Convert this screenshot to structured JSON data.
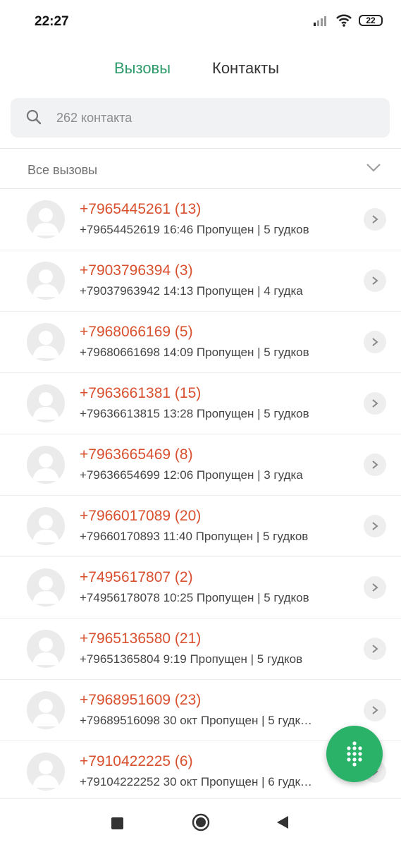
{
  "status": {
    "time": "22:27",
    "battery": "22"
  },
  "tabs": {
    "calls": "Вызовы",
    "contacts": "Контакты"
  },
  "search": {
    "placeholder": "262 контакта"
  },
  "filter": {
    "label": "Все вызовы"
  },
  "calls": [
    {
      "title": "+7965445261 (13)",
      "sub": "+79654452619  16:46 Пропущен | 5 гудков"
    },
    {
      "title": "+7903796394 (3)",
      "sub": "+79037963942  14:13 Пропущен | 4 гудка"
    },
    {
      "title": "+7968066169 (5)",
      "sub": "+79680661698  14:09 Пропущен | 5 гудков"
    },
    {
      "title": "+7963661381 (15)",
      "sub": "+79636613815  13:28 Пропущен | 5 гудков"
    },
    {
      "title": "+7963665469 (8)",
      "sub": "+79636654699  12:06 Пропущен | 3 гудка"
    },
    {
      "title": "+7966017089 (20)",
      "sub": "+79660170893  11:40 Пропущен | 5 гудков"
    },
    {
      "title": "+7495617807 (2)",
      "sub": "+74956178078  10:25 Пропущен | 5 гудков"
    },
    {
      "title": "+7965136580 (21)",
      "sub": "+79651365804  9:19 Пропущен | 5 гудков"
    },
    {
      "title": "+7968951609 (23)",
      "sub": "+79689516098  30 окт Пропущен | 5 гудк…"
    },
    {
      "title": "+7910422225 (6)",
      "sub": "+79104222252  30 окт Пропущен | 6 гудк…"
    }
  ],
  "icons": {
    "signal": "signal-icon",
    "wifi": "wifi-icon",
    "battery": "battery-icon",
    "search": "search-icon",
    "chevron_down": "chevron-down-icon",
    "avatar": "avatar-icon",
    "chevron_right": "chevron-right-icon",
    "dialpad": "dialpad-icon",
    "recents": "square-icon",
    "home": "home-circle-icon",
    "back": "back-triangle-icon"
  },
  "colors": {
    "accent": "#2e9b6b",
    "missed": "#d9502f",
    "fab": "#2ab268"
  }
}
